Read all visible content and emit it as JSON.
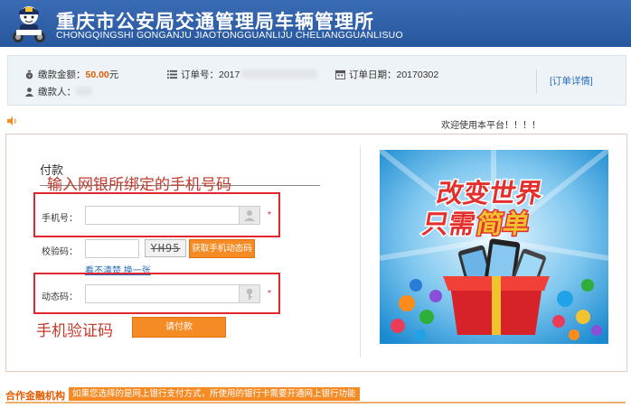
{
  "header": {
    "title_cn": "重庆市公安局交通管理局车辆管理所",
    "title_en": "CHONGQINGSHI GONGANJU JIAOTONGGUANLIJU CHELIANGGUANLISUO"
  },
  "order": {
    "amount_label": "缴款金额：",
    "amount_value": "50.00",
    "amount_unit": "元",
    "payer_label": "缴款人：",
    "order_no_label": "订单号：",
    "order_no_value": "2017",
    "order_date_label": "订单日期：",
    "order_date_value": "20170302",
    "detail_link": "[订单详情]"
  },
  "welcome": "欢迎使用本平台！！！！",
  "form": {
    "title": "付款",
    "annotation_top": "输入网银所绑定的手机号码",
    "annotation_bottom": "手机验证码",
    "phone_label": "手机号：",
    "phone_required": "*",
    "captcha_label": "校验码：",
    "captcha_text": "YH95",
    "sms_button": "获取手机动态码",
    "refresh_link": "看不清楚,换一张",
    "dynamic_label": "动态码：",
    "dynamic_required": "*",
    "pay_button": "请付款"
  },
  "banner": {
    "line1": "改变世界",
    "line2a": "只需",
    "line2b": "简单"
  },
  "footer": {
    "label": "合作金融机构",
    "note": "如果您选择的是网上银行支付方式，所使用的银行卡需要开通网上银行功能"
  },
  "colors": {
    "header_bg": "#2e5fa8",
    "accent_orange": "#f58b25",
    "annotation_red": "#e0262e",
    "link_blue": "#2a6ebb"
  },
  "icons": [
    "police-logo-icon",
    "money-bag-icon",
    "user-icon",
    "list-icon",
    "calendar-icon",
    "speaker-icon",
    "person-icon",
    "key-icon"
  ]
}
